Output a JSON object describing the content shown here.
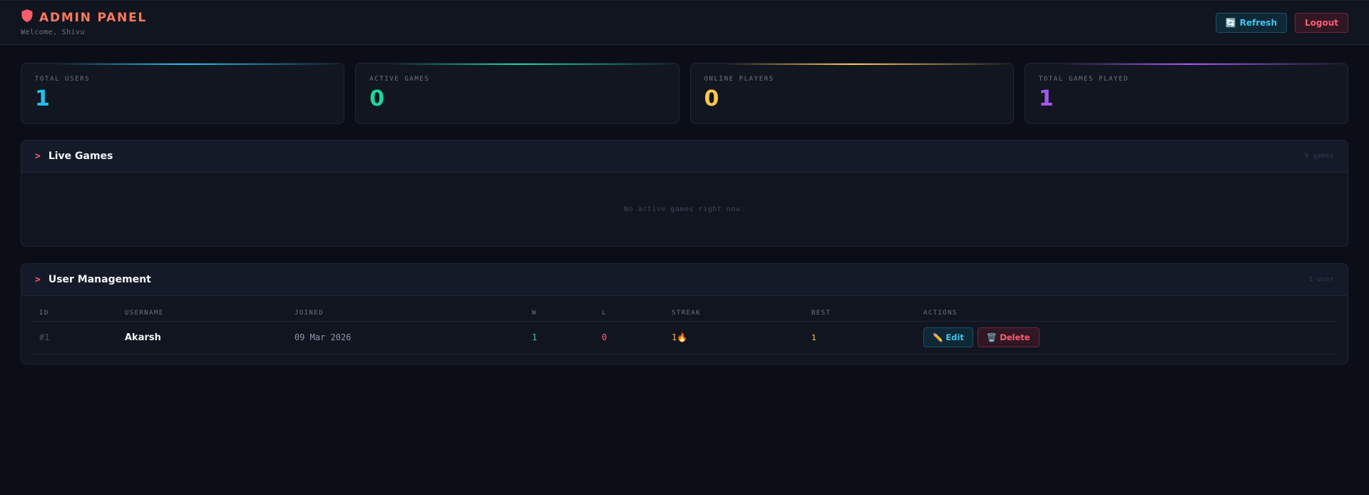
{
  "header": {
    "title": "ADMIN PANEL",
    "welcome": "Welcome, Shivu",
    "refresh_label": "Refresh",
    "refresh_icon": "🔄",
    "logout_label": "Logout"
  },
  "stats": [
    {
      "label": "TOTAL USERS",
      "value": "1",
      "accent": "#22c0ee"
    },
    {
      "label": "ACTIVE GAMES",
      "value": "0",
      "accent": "#17d9a0"
    },
    {
      "label": "ONLINE PLAYERS",
      "value": "0",
      "accent": "#ffc94d"
    },
    {
      "label": "TOTAL GAMES PLAYED",
      "value": "1",
      "accent": "#a855f7"
    }
  ],
  "live_games": {
    "chevron": ">",
    "title": "Live Games",
    "count": "0 games",
    "empty_message": "No active games right now."
  },
  "users": {
    "chevron": ">",
    "title": "User Management",
    "count": "1 user",
    "columns": [
      "ID",
      "USERNAME",
      "JOINED",
      "W",
      "L",
      "STREAK",
      "BEST",
      "ACTIONS"
    ],
    "rows": [
      {
        "id": "#1",
        "username": "Akarsh",
        "joined": "09 Mar 2026",
        "w": "1",
        "l": "0",
        "streak": "1🔥",
        "best": "1",
        "edit_label": "Edit",
        "edit_icon": "✏️",
        "delete_label": "Delete",
        "delete_icon": "🗑️"
      }
    ]
  },
  "colors": {
    "brand": "#ff7a5c",
    "cyan": "#3fc6ee",
    "red": "#ff5c77",
    "background": "#0b0e16"
  }
}
